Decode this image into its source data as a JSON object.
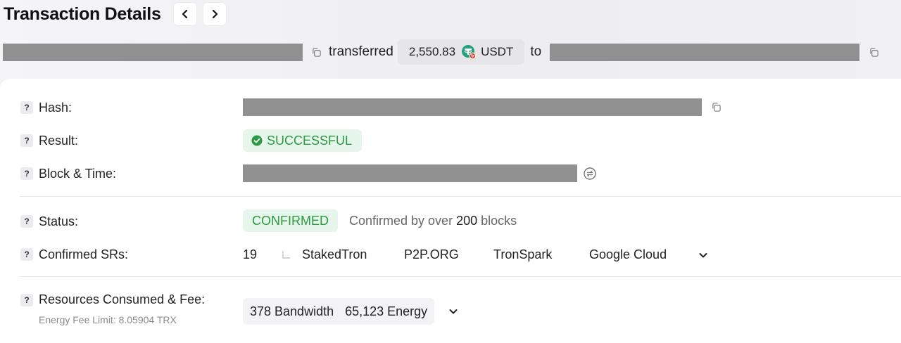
{
  "header": {
    "title": "Transaction Details",
    "prev_icon": "chevron-left-icon",
    "next_icon": "chevron-right-icon"
  },
  "transfer": {
    "word_transferred": "transferred",
    "amount": "2,550.83",
    "token": "USDT",
    "word_to": "to"
  },
  "details": {
    "hash_label": "Hash:",
    "result_label": "Result:",
    "result_value": "SUCCESSFUL",
    "block_time_label": "Block & Time:",
    "status_label": "Status:",
    "status_value": "CONFIRMED",
    "confirm_prefix": "Confirmed by over",
    "confirm_blocks": "200",
    "confirm_suffix": "blocks",
    "srs_label": "Confirmed SRs:",
    "srs_count": "19",
    "srs": [
      "StakedTron",
      "P2P.ORG",
      "TronSpark",
      "Google Cloud"
    ],
    "resources_label": "Resources Consumed & Fee:",
    "energy_fee_limit": "Energy Fee Limit: 8.05904 TRX",
    "bandwidth": "378 Bandwidth",
    "energy": "65,123 Energy",
    "help_glyph": "?"
  },
  "colors": {
    "success_green": "#2b9a43",
    "success_bg": "#e7f6ea",
    "redaction_gray": "#909090",
    "tether_green": "#26a17b",
    "tron_red": "#e6442b"
  }
}
